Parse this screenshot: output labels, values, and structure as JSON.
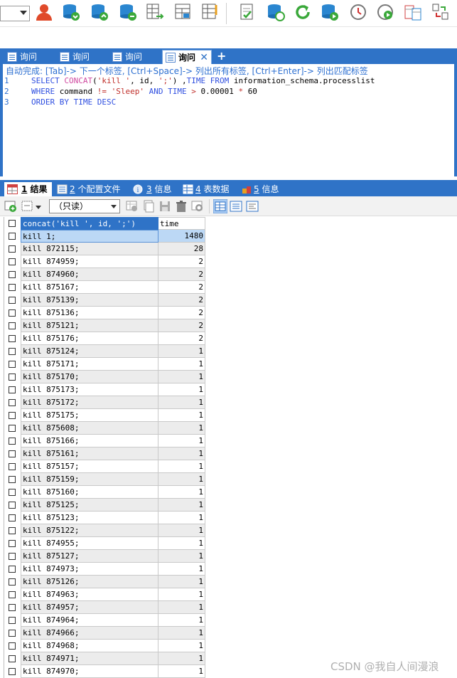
{
  "tabs": [
    {
      "label": "询问"
    },
    {
      "label": "询问"
    },
    {
      "label": "询问"
    },
    {
      "label": "询问",
      "active": true
    }
  ],
  "editor": {
    "hint": "自动完成: [Tab]-> 下一个标签, [Ctrl+Space]-> 列出所有标签, [Ctrl+Enter]-> 列出匹配标签",
    "lines": [
      {
        "n": "1",
        "tokens": [
          [
            "kw",
            "SELECT "
          ],
          [
            "fn",
            "CONCAT"
          ],
          [
            "plain",
            "("
          ],
          [
            "str",
            "'kill '"
          ],
          [
            "plain",
            ", id, "
          ],
          [
            "str",
            "';'"
          ],
          [
            "plain",
            ") ,"
          ],
          [
            "kw",
            "TIME FROM "
          ],
          [
            "plain",
            "information_schema.processlist"
          ]
        ]
      },
      {
        "n": "2",
        "tokens": [
          [
            "kw",
            "WHERE "
          ],
          [
            "plain",
            "command "
          ],
          [
            "op",
            "!= "
          ],
          [
            "str",
            "'Sleep' "
          ],
          [
            "kw",
            "AND TIME "
          ],
          [
            "op",
            "> "
          ],
          [
            "num",
            "0.00001 "
          ],
          [
            "op",
            "* "
          ],
          [
            "num",
            "60"
          ]
        ]
      },
      {
        "n": "3",
        "tokens": [
          [
            "kw",
            "ORDER BY TIME DESC"
          ]
        ]
      }
    ]
  },
  "result_tabs": [
    {
      "num": "1",
      "label": " 结果",
      "active": true
    },
    {
      "num": "2",
      "label": " 个配置文件"
    },
    {
      "num": "3",
      "label": " 信息"
    },
    {
      "num": "4",
      "label": " 表数据"
    },
    {
      "num": "5",
      "label": " 信息"
    }
  ],
  "result_toolbar": {
    "mode": "（只读）"
  },
  "grid": {
    "columns": [
      "concat('kill ', id, ';')",
      "time"
    ],
    "rows": [
      [
        "kill 1;",
        "1480"
      ],
      [
        "kill 872115;",
        "28"
      ],
      [
        "kill 874959;",
        "2"
      ],
      [
        "kill 874960;",
        "2"
      ],
      [
        "kill 875167;",
        "2"
      ],
      [
        "kill 875139;",
        "2"
      ],
      [
        "kill 875136;",
        "2"
      ],
      [
        "kill 875121;",
        "2"
      ],
      [
        "kill 875176;",
        "2"
      ],
      [
        "kill 875124;",
        "1"
      ],
      [
        "kill 875171;",
        "1"
      ],
      [
        "kill 875170;",
        "1"
      ],
      [
        "kill 875173;",
        "1"
      ],
      [
        "kill 875172;",
        "1"
      ],
      [
        "kill 875175;",
        "1"
      ],
      [
        "kill 875608;",
        "1"
      ],
      [
        "kill 875166;",
        "1"
      ],
      [
        "kill 875161;",
        "1"
      ],
      [
        "kill 875157;",
        "1"
      ],
      [
        "kill 875159;",
        "1"
      ],
      [
        "kill 875160;",
        "1"
      ],
      [
        "kill 875125;",
        "1"
      ],
      [
        "kill 875123;",
        "1"
      ],
      [
        "kill 875122;",
        "1"
      ],
      [
        "kill 874955;",
        "1"
      ],
      [
        "kill 875127;",
        "1"
      ],
      [
        "kill 874973;",
        "1"
      ],
      [
        "kill 875126;",
        "1"
      ],
      [
        "kill 874963;",
        "1"
      ],
      [
        "kill 874957;",
        "1"
      ],
      [
        "kill 874964;",
        "1"
      ],
      [
        "kill 874966;",
        "1"
      ],
      [
        "kill 874968;",
        "1"
      ],
      [
        "kill 874971;",
        "1"
      ],
      [
        "kill 874970;",
        "1"
      ]
    ]
  },
  "watermark": "CSDN @我自人间漫浪",
  "colors": {
    "accent": "#2f73c7",
    "selected_row": "#bcd8f5",
    "alt_row": "#ececec"
  }
}
